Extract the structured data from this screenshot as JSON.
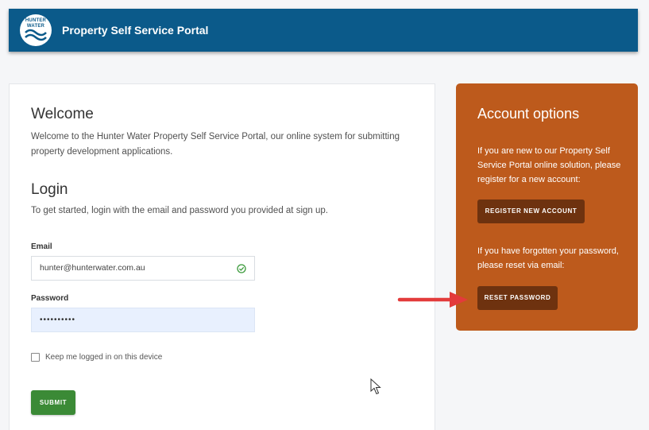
{
  "header": {
    "logo_text": "HUNTER WATER",
    "title": "Property Self Service Portal",
    "background_color": "#0b5a8a"
  },
  "welcome": {
    "title": "Welcome",
    "text": "Welcome to the Hunter Water Property Self Service Portal, our online system for submitting property development applications."
  },
  "login": {
    "title": "Login",
    "text": "To get started, login with the email and password you provided at sign up.",
    "email_label": "Email",
    "email_value": "hunter@hunterwater.com.au",
    "email_valid_icon": "check-circle-icon",
    "password_label": "Password",
    "password_value": "••••••••••",
    "remember_label": "Keep me logged in on this device",
    "remember_checked": false,
    "submit_label": "SUBMIT",
    "submit_color": "#3b8a36"
  },
  "account_options": {
    "title": "Account options",
    "register_text": "If you are new to our Property Self Service Portal online solution, please register for a new account:",
    "register_button": "REGISTER NEW ACCOUNT",
    "reset_text": "If you have forgotten your password, please reset via email:",
    "reset_button": "RESET PASSWORD",
    "panel_color": "#bd5a1c",
    "button_color": "#6e320f"
  },
  "annotation": {
    "arrow_icon": "red-arrow-icon",
    "arrow_color": "#e33b3b"
  }
}
